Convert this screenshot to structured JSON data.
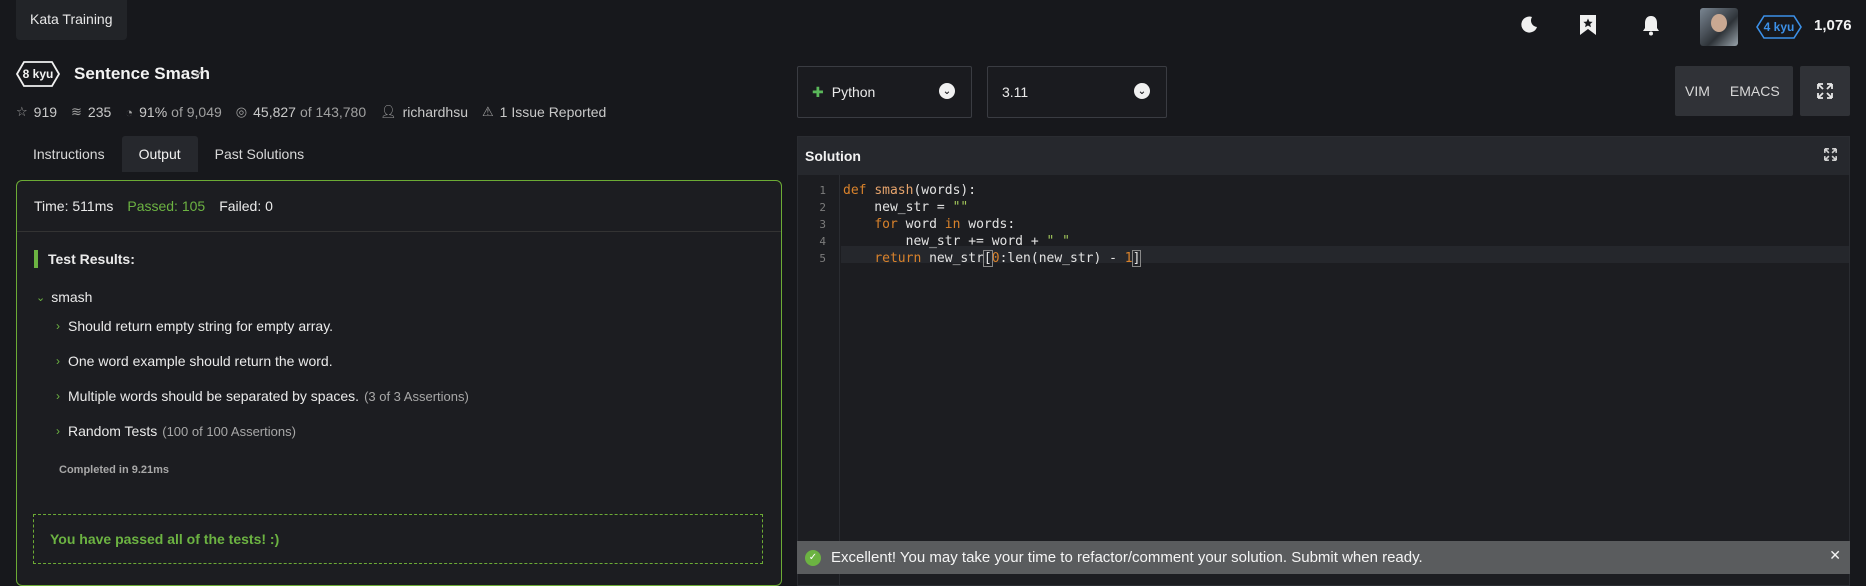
{
  "nav": {
    "kata_training": "Kata Training",
    "rank": "4 kyu",
    "honor": "1,076",
    "icons": [
      "moon-icon",
      "bookmark-star-icon",
      "bell-icon"
    ]
  },
  "kata": {
    "kyu": "8 kyu",
    "title": "Sentence Smash",
    "stats": {
      "stars": "919",
      "collections": "235",
      "satisfaction": "91%",
      "satisfaction_of": "of 9,049",
      "completed": "45,827",
      "completed_of": "of 143,780",
      "author": "richardhsu",
      "issues": "1 Issue Reported"
    }
  },
  "tabs": [
    "Instructions",
    "Output",
    "Past Solutions"
  ],
  "output": {
    "time": "Time: 511ms",
    "passed": "Passed: 105",
    "failed": "Failed: 0",
    "results_title": "Test Results:",
    "describe": "smash",
    "tests": [
      {
        "name": "Should return empty string for empty array.",
        "assertions": ""
      },
      {
        "name": "One word example should return the word.",
        "assertions": ""
      },
      {
        "name": "Multiple words should be separated by spaces.",
        "assertions": "(3 of 3 Assertions)"
      },
      {
        "name": "Random Tests",
        "assertions": "(100 of 100 Assertions)"
      }
    ],
    "completed": "Completed in 9.21ms",
    "pass_message": "You have passed all of the tests! :)"
  },
  "editor": {
    "language": "Python",
    "version": "3.11",
    "modes": [
      "VIM",
      "EMACS"
    ],
    "panel_title": "Solution",
    "line_numbers": [
      "1",
      "2",
      "3",
      "4",
      "5"
    ]
  },
  "notification": {
    "text": "Excellent! You may take your time to refactor/comment your solution. Submit when ready."
  },
  "colors": {
    "accent_green": "#6cb342",
    "rank_blue": "#3c90e8",
    "background": "#17181c"
  }
}
